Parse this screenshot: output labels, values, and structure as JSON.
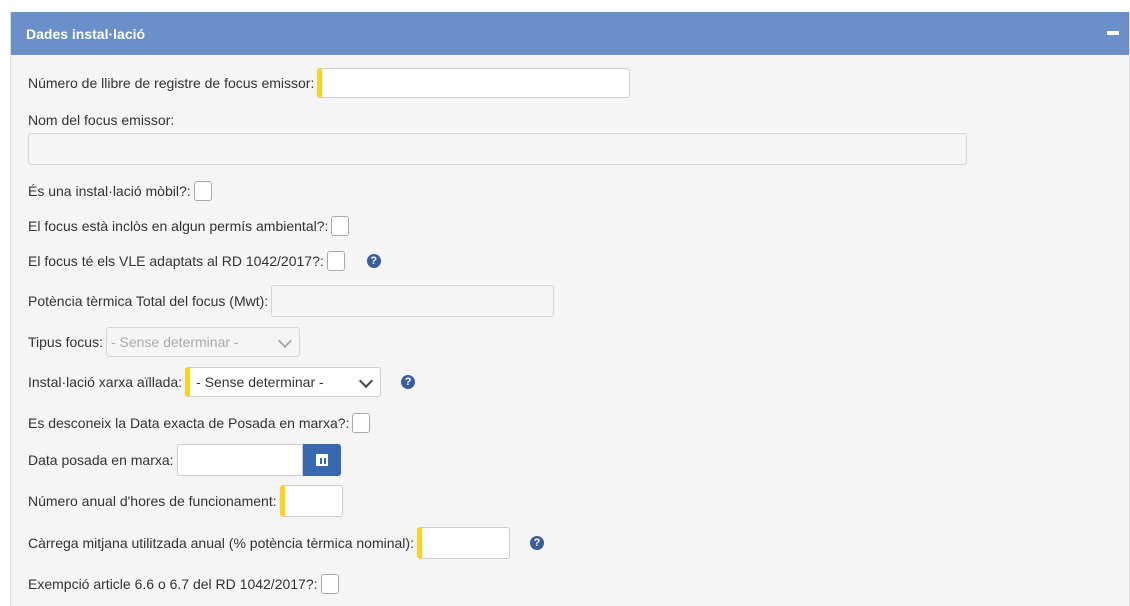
{
  "panel": {
    "title": "Dades instal·lació",
    "collapse_symbol": "−"
  },
  "fields": {
    "llibre_registre": {
      "label": "Número de llibre de registre de focus emissor:",
      "value": ""
    },
    "nom_focus": {
      "label": "Nom del focus emissor:",
      "value": ""
    },
    "installacio_mobil": {
      "label": "És una instal·lació mòbil?:"
    },
    "permis_ambiental": {
      "label": "El focus està inclòs en algun permís ambiental?:"
    },
    "vle_adaptats": {
      "label": "El focus té els VLE adaptats al RD 1042/2017?:"
    },
    "potencia_termica": {
      "label": "Potència tèrmica Total del focus (Mwt):",
      "value": ""
    },
    "tipus_focus": {
      "label": "Tipus focus:",
      "selected": "- Sense determinar -"
    },
    "xarxa_aillada": {
      "label": "Instal·lació xarxa aïllada:",
      "selected": "- Sense determinar -"
    },
    "data_desconeguda": {
      "label": "Es desconeix la Data exacta de Posada en marxa?:"
    },
    "data_posada": {
      "label": "Data posada en marxa:",
      "value": ""
    },
    "hores_funcionament": {
      "label": "Número anual d'hores de funcionament:",
      "value": ""
    },
    "carrega_mitjana": {
      "label": "Càrrega mitjana utilitzada anual (% potència tèrmica nominal):",
      "value": ""
    },
    "exempcio": {
      "label": "Exempció article 6.6 o 6.7 del RD 1042/2017?:"
    }
  },
  "icons": {
    "help": "question-circle-icon",
    "calendar": "calendar-icon"
  },
  "colors": {
    "header": "#6a8fc9",
    "required_marker": "#ffd21f",
    "button": "#3a68b0",
    "help": "#3a5e9a"
  }
}
